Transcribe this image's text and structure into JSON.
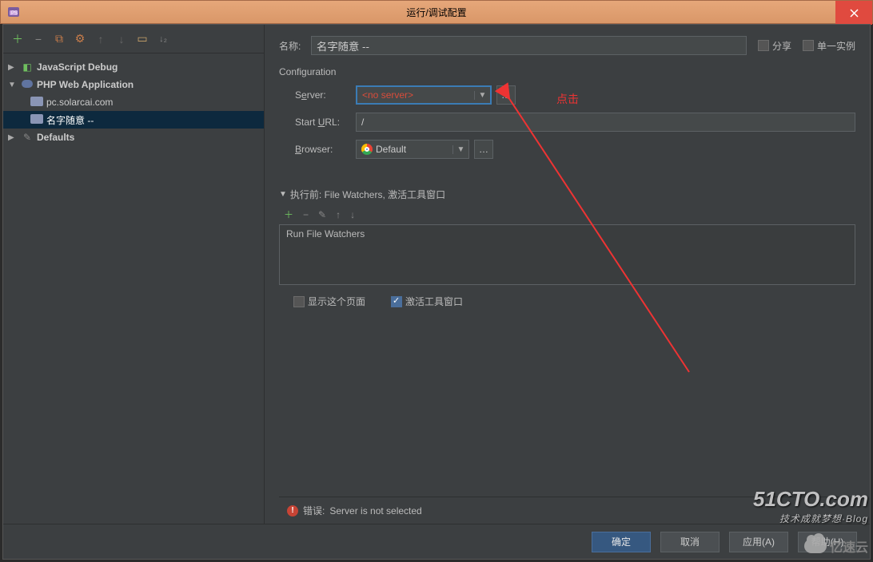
{
  "window": {
    "title": "运行/调试配置"
  },
  "annotation": {
    "click_label": "点击"
  },
  "header": {
    "name_label": "名称:",
    "name_value": "名字随意 --",
    "share_label": "分享",
    "single_instance_label": "单一实例"
  },
  "tree": {
    "js_debug": "JavaScript Debug",
    "php_web_app": "PHP Web Application",
    "items": [
      {
        "label": "pc.solarcai.com"
      },
      {
        "label": "名字随意 --"
      }
    ],
    "defaults": "Defaults"
  },
  "config": {
    "title": "Configuration",
    "server_label_pre": "S",
    "server_label_u": "e",
    "server_label_post": "rver:",
    "server_value": "<no server>",
    "url_label_pre": "Start ",
    "url_label_u": "U",
    "url_label_post": "RL:",
    "url_value": "/",
    "browser_label_u": "B",
    "browser_label_post": "rowser:",
    "browser_value": "Default"
  },
  "before": {
    "header": "执行前: File Watchers, 激活工具窗口",
    "task": "Run File Watchers"
  },
  "checks": {
    "show_page": "显示这个页面",
    "activate_tool": "激活工具窗口"
  },
  "error": {
    "label": "错误:",
    "msg": "Server is not selected"
  },
  "buttons": {
    "ok": "确定",
    "cancel": "取消",
    "apply": "应用(A)",
    "help": "帮助(H)"
  },
  "watermarks": {
    "w1": "51CTO.com",
    "w1s": "技术成就梦想·Blog",
    "w2": "亿速云"
  }
}
